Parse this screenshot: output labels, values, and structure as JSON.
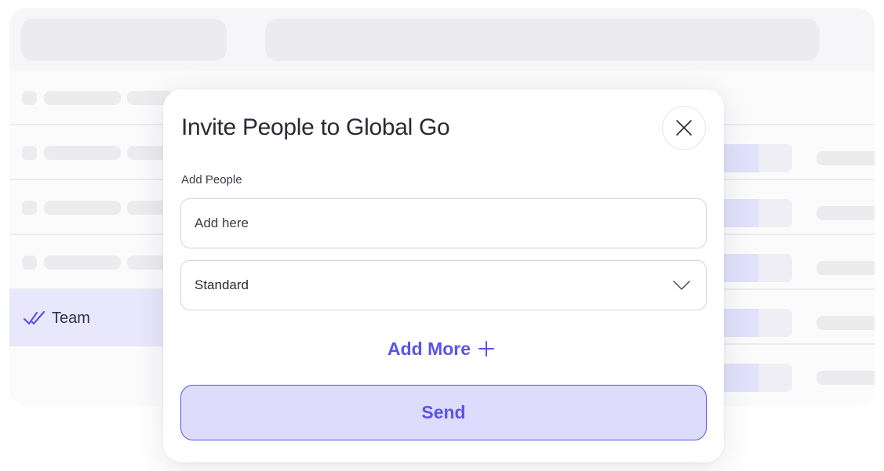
{
  "sidebar": {
    "active_item": {
      "label": "Team",
      "icon": "double-check-icon"
    }
  },
  "modal": {
    "title": "Invite People to Global Go",
    "close_icon": "close-icon",
    "field_label": "Add People",
    "input": {
      "value": "",
      "placeholder": "Add here"
    },
    "select": {
      "value": "Standard",
      "icon": "chevron-down-icon"
    },
    "add_more": {
      "label": "Add More",
      "icon": "plus-icon"
    },
    "send_label": "Send"
  },
  "colors": {
    "accent": "#5b54e6",
    "accent_light": "#dedcfc",
    "active_row": "#e8e7fb"
  }
}
